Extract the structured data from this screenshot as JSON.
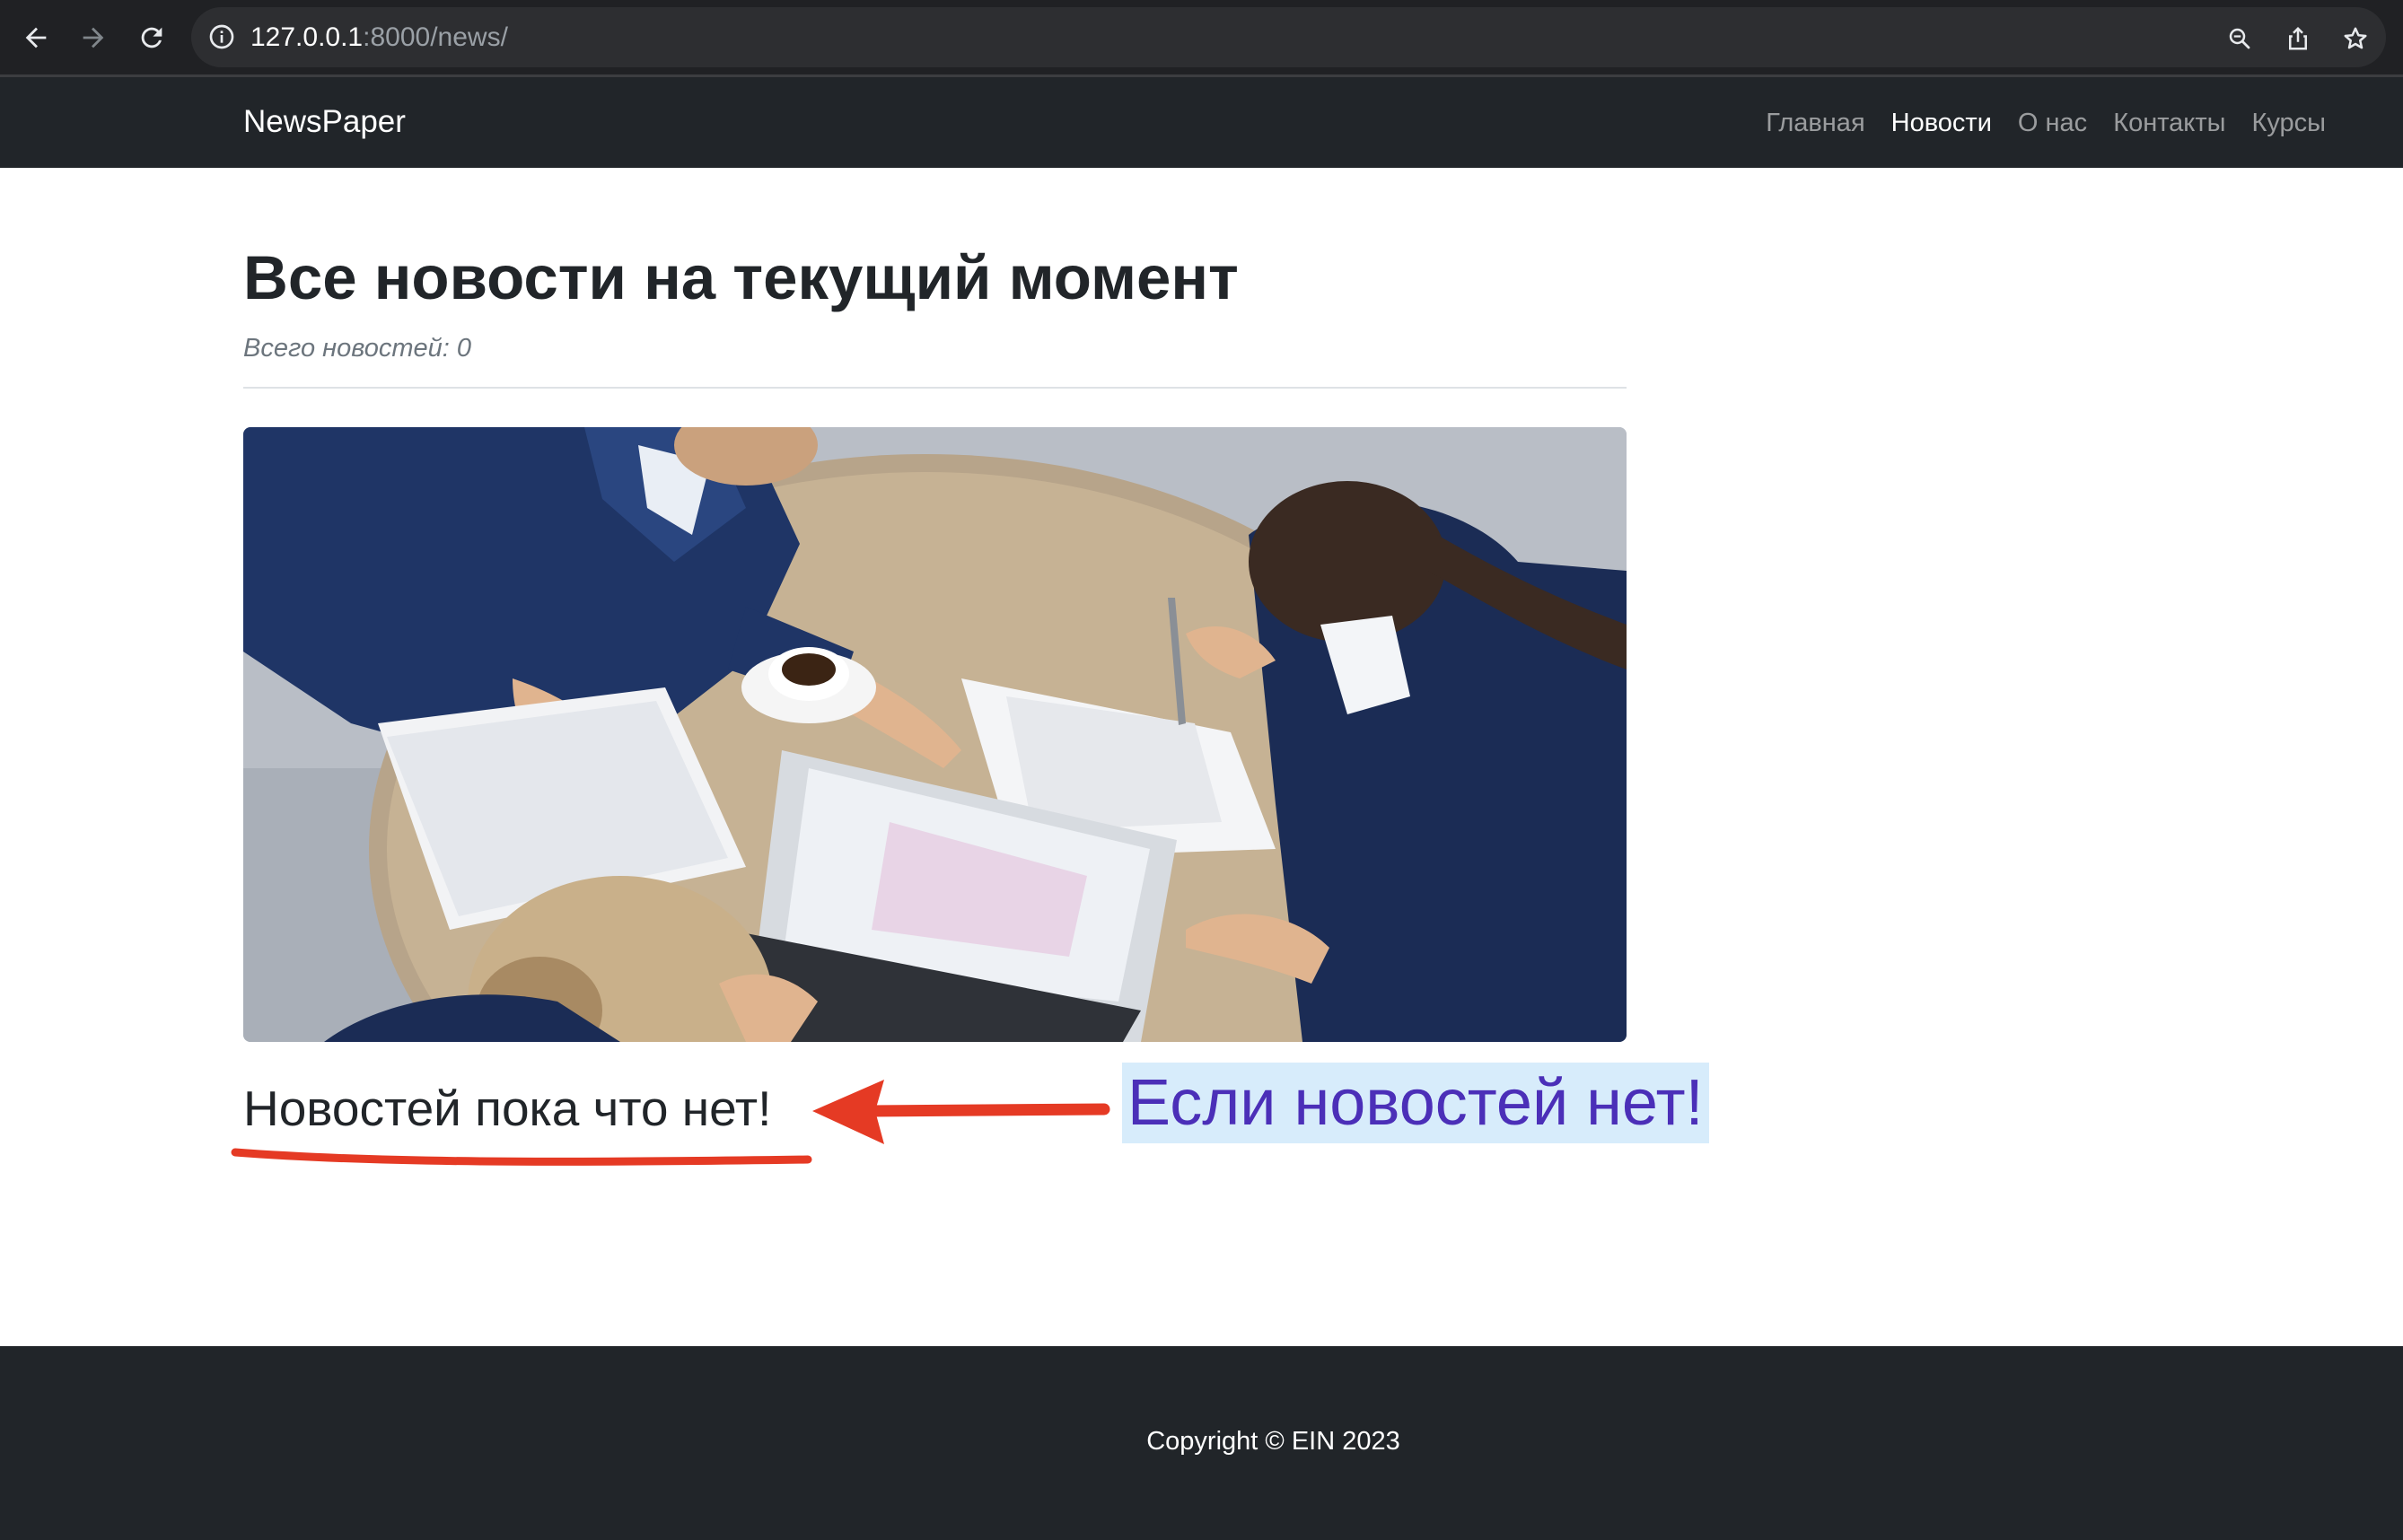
{
  "browser": {
    "url_host": "127.0.0.1",
    "url_rest": ":8000/news/",
    "icons": [
      "back-arrow-icon",
      "forward-arrow-icon",
      "reload-icon",
      "info-icon",
      "zoom-icon",
      "share-icon",
      "star-icon"
    ]
  },
  "navbar": {
    "brand": "NewsPaper",
    "items": [
      {
        "label": "Главная",
        "active": false
      },
      {
        "label": "Новости",
        "active": true
      },
      {
        "label": "О нас",
        "active": false
      },
      {
        "label": "Контакты",
        "active": false
      },
      {
        "label": "Курсы",
        "active": false
      }
    ]
  },
  "main": {
    "title": "Все новости на текущий момент",
    "subtitle": "Всего новостей: 0",
    "empty_message": "Новостей пока что нет!"
  },
  "annotation": {
    "label": "Если новостей нет!",
    "arrow_color": "#e53a24",
    "label_color": "#4b2fb8",
    "label_background": "#d7ecfb"
  },
  "footer": {
    "copyright": "Copyright © EIN 2023"
  },
  "colors": {
    "chrome": "#202124",
    "navbar": "#212529",
    "footer": "#212529"
  }
}
